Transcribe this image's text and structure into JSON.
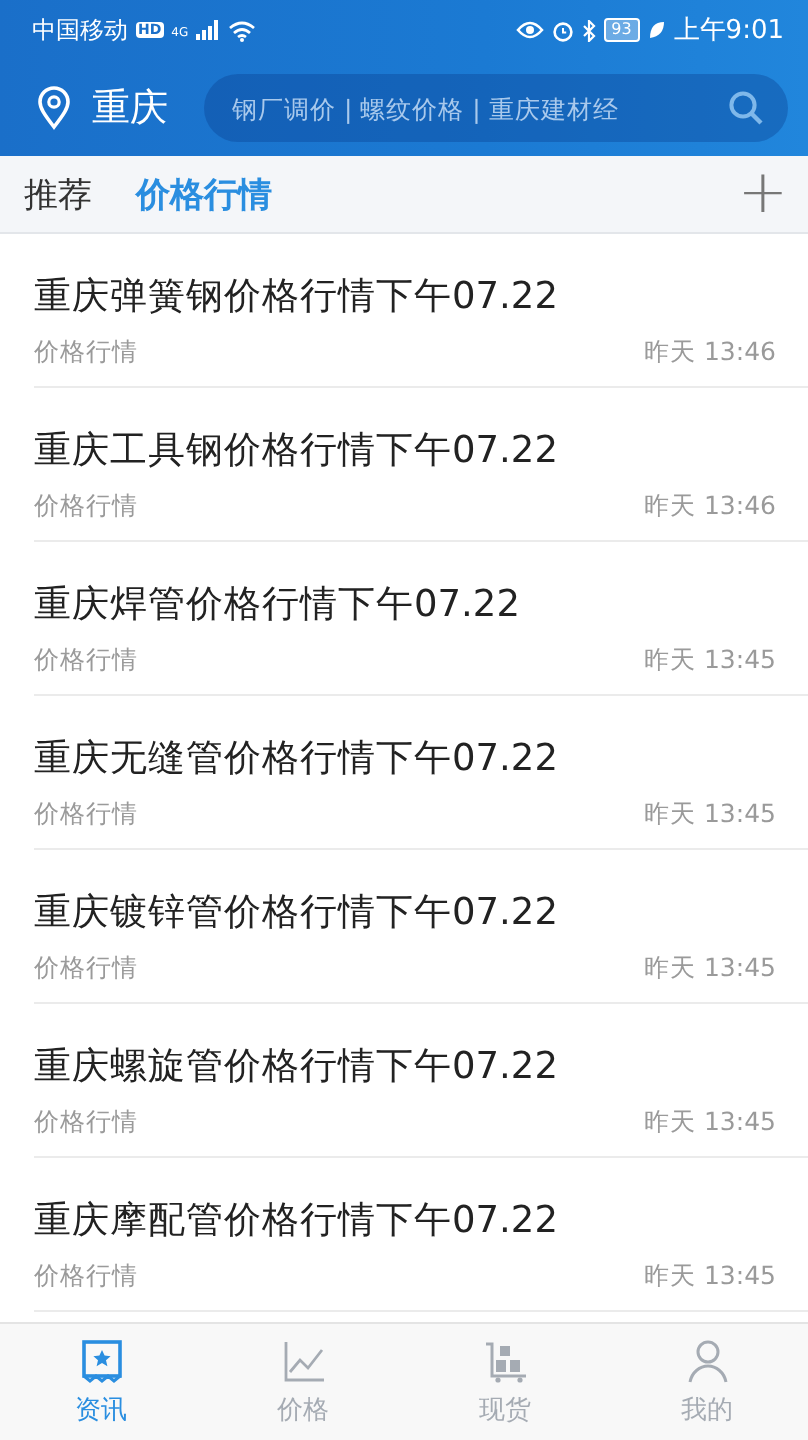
{
  "status_bar": {
    "carrier": "中国移动",
    "hd": "HD",
    "network": "4G",
    "battery": "93",
    "time": "上午9:01"
  },
  "header": {
    "city": "重庆",
    "search": {
      "placeholder": "钢厂调价 | 螺纹价格 | 重庆建材经"
    }
  },
  "tabs": [
    {
      "label": "推荐",
      "selected": false
    },
    {
      "label": "价格行情",
      "selected": true
    }
  ],
  "add_label": "+",
  "articles": [
    {
      "title": "重庆弹簧钢价格行情下午07.22",
      "category": "价格行情",
      "time": "昨天 13:46"
    },
    {
      "title": "重庆工具钢价格行情下午07.22",
      "category": "价格行情",
      "time": "昨天 13:46"
    },
    {
      "title": "重庆焊管价格行情下午07.22",
      "category": "价格行情",
      "time": "昨天 13:45"
    },
    {
      "title": "重庆无缝管价格行情下午07.22",
      "category": "价格行情",
      "time": "昨天 13:45"
    },
    {
      "title": "重庆镀锌管价格行情下午07.22",
      "category": "价格行情",
      "time": "昨天 13:45"
    },
    {
      "title": "重庆螺旋管价格行情下午07.22",
      "category": "价格行情",
      "time": "昨天 13:45"
    },
    {
      "title": "重庆摩配管价格行情下午07.22",
      "category": "价格行情",
      "time": "昨天 13:45"
    }
  ],
  "bottom_nav": [
    {
      "label": "资讯",
      "kind": "news",
      "selected": true
    },
    {
      "label": "价格",
      "kind": "chart",
      "selected": false
    },
    {
      "label": "现货",
      "kind": "stock",
      "selected": false
    },
    {
      "label": "我的",
      "kind": "profile",
      "selected": false
    }
  ]
}
